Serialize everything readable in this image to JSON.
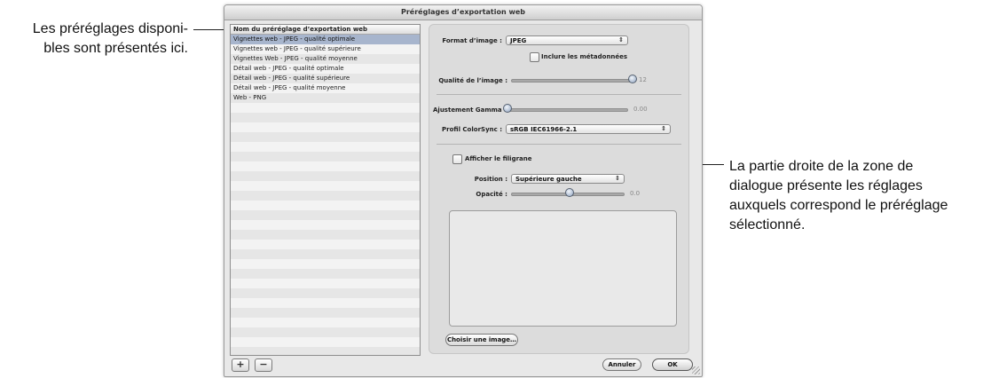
{
  "callouts": {
    "left": [
      "Les préréglages disponi-",
      "bles sont présentés ici."
    ],
    "right": [
      "La partie droite de la zone de",
      "dialogue présente les réglages",
      "auxquels correspond le préréglage",
      "sélectionné."
    ]
  },
  "window": {
    "title": "Préréglages d’exportation web"
  },
  "preset_list": {
    "header": "Nom du préréglage d’exportation web",
    "items": [
      "Vignettes web - JPEG - qualité optimale",
      "Vignettes web - JPEG - qualité supérieure",
      "Vignettes Web - JPEG - qualité moyenne",
      "Détail web - JPEG - qualité optimale",
      "Détail web - JPEG - qualité supérieure",
      "Détail web - JPEG - qualité moyenne",
      "Web - PNG"
    ],
    "selected_index": 0,
    "add_label": "+",
    "remove_label": "−"
  },
  "settings": {
    "format_label": "Format d’image :",
    "format_value": "JPEG",
    "include_metadata_label": "Inclure les métadonnées",
    "quality_label": "Qualité de l’image :",
    "quality_value": "12",
    "gamma_label": "Ajustement Gamma :",
    "gamma_value": "0.00",
    "colorsync_label": "Profil ColorSync :",
    "colorsync_value": "sRGB IEC61966-2.1",
    "watermark_label": "Afficher le filigrane",
    "position_label": "Position :",
    "position_value": "Supérieure gauche",
    "opacity_label": "Opacité :",
    "opacity_value": "0.0",
    "choose_image_label": "Choisir une image…"
  },
  "buttons": {
    "cancel": "Annuler",
    "ok": "OK"
  },
  "colors": {
    "selection": "#a7b5cd",
    "window_bg": "#e8e8e8"
  }
}
